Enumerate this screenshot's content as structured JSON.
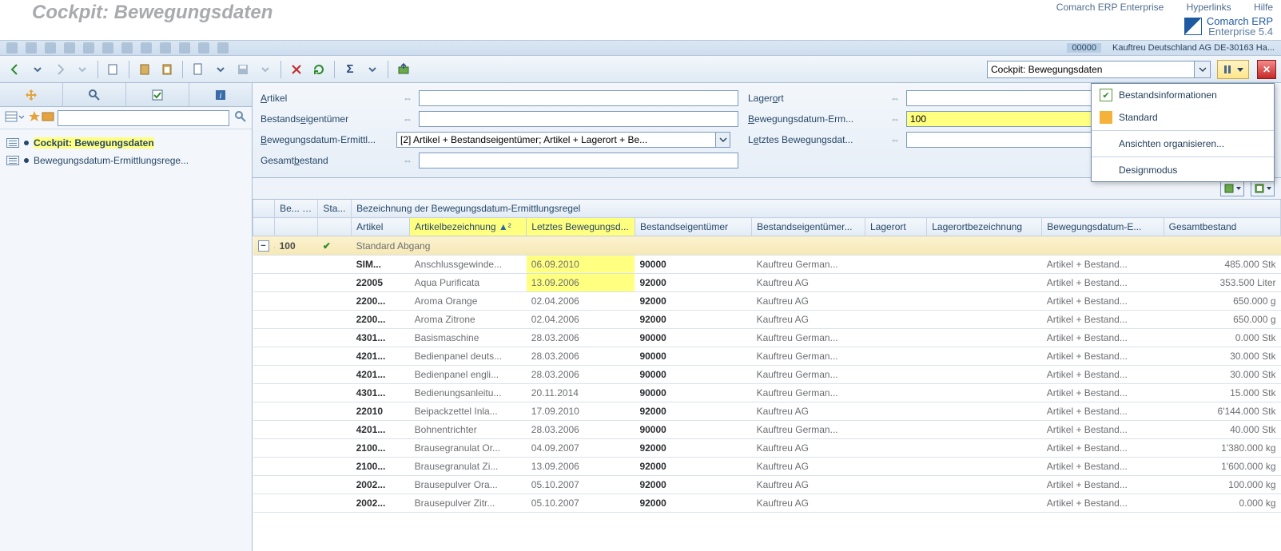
{
  "top": {
    "title": "Cockpit: Bewegungsdaten",
    "links": {
      "erp": "Comarch ERP Enterprise",
      "hyper": "Hyperlinks",
      "help": "Hilfe"
    },
    "brand_l1": "Comarch ERP",
    "brand_l2": "Enterprise 5.4"
  },
  "smallbar": {
    "code": "00000",
    "org": "Kauftreu Deutschland AG  DE-30163 Ha..."
  },
  "toolbar": {
    "combo_value": "Cockpit: Bewegungsdaten"
  },
  "menu": {
    "i1": "Bestandsinformationen",
    "i2": "Standard",
    "i3": "Ansichten organisieren...",
    "i4": "Designmodus"
  },
  "tree": {
    "n1": "Cockpit: Bewegungsdaten",
    "n2": "Bewegungsdatum-Ermittlungsrege..."
  },
  "filter": {
    "artikel": "Artikel",
    "bestandseig": "Bestandseigentümer",
    "bew_regel": "Bewegungsdatum-Ermittl...",
    "bew_regel_under": "B",
    "gesamt": "Gesamtbestand",
    "gesamt_under": "b",
    "lagerort": "Lagerort",
    "lagerort_under": "o",
    "bew_zahl": "Bewegungsdatum-Erm...",
    "bew_zahl_under": "B",
    "bew_zahl_val": "100",
    "letztes": "Letztes Bewegungsdat...",
    "letztes_under": "e",
    "regel_value": "[2] Artikel + Bestandseigentümer; Artikel + Lagerort + Be..."
  },
  "grid": {
    "h1": {
      "be": "Be...",
      "sort": "▲¹",
      "st": "Sta...",
      "rule": "Bezeichnung der Bewegungsdatum-Ermittlungsregel"
    },
    "h2": {
      "art": "Artikel",
      "artb": "Artikelbezeichnung",
      "artb_sort": "▲²",
      "date": "Letztes Bewegungsd...",
      "own": "Bestandseigentümer",
      "ownb": "Bestandseigentümer...",
      "lag": "Lagerort",
      "lagb": "Lagerortbezeichnung",
      "reg": "Bewegungsdatum-E...",
      "tot": "Gesamtbestand"
    },
    "group": {
      "be": "100",
      "rule": "Standard Abgang"
    },
    "rows": [
      {
        "hl": true,
        "art": "SIM...",
        "artb": "Anschlussgewinde...",
        "date": "06.09.2010",
        "own": "90000",
        "ownb": "Kauftreu German...",
        "lag": "",
        "lagb": "",
        "reg": "Artikel + Bestand...",
        "tot": "485.000 Stk"
      },
      {
        "hl": true,
        "art": "22005",
        "artb": "Aqua Purificata",
        "date": "13.09.2006",
        "own": "92000",
        "ownb": "Kauftreu AG",
        "lag": "",
        "lagb": "",
        "reg": "Artikel + Bestand...",
        "tot": "353.500 Liter"
      },
      {
        "hl": false,
        "art": "2200...",
        "artb": "Aroma Orange",
        "date": "02.04.2006",
        "own": "92000",
        "ownb": "Kauftreu AG",
        "lag": "",
        "lagb": "",
        "reg": "Artikel + Bestand...",
        "tot": "650.000 g"
      },
      {
        "hl": false,
        "art": "2200...",
        "artb": "Aroma Zitrone",
        "date": "02.04.2006",
        "own": "92000",
        "ownb": "Kauftreu AG",
        "lag": "",
        "lagb": "",
        "reg": "Artikel + Bestand...",
        "tot": "650.000 g"
      },
      {
        "hl": false,
        "art": "4301...",
        "artb": "Basismaschine",
        "date": "28.03.2006",
        "own": "90000",
        "ownb": "Kauftreu German...",
        "lag": "",
        "lagb": "",
        "reg": "Artikel + Bestand...",
        "tot": "0.000 Stk"
      },
      {
        "hl": false,
        "art": "4201...",
        "artb": "Bedienpanel deuts...",
        "date": "28.03.2006",
        "own": "90000",
        "ownb": "Kauftreu German...",
        "lag": "",
        "lagb": "",
        "reg": "Artikel + Bestand...",
        "tot": "30.000 Stk"
      },
      {
        "hl": false,
        "art": "4201...",
        "artb": "Bedienpanel engli...",
        "date": "28.03.2006",
        "own": "90000",
        "ownb": "Kauftreu German...",
        "lag": "",
        "lagb": "",
        "reg": "Artikel + Bestand...",
        "tot": "30.000 Stk"
      },
      {
        "hl": false,
        "art": "4301...",
        "artb": "Bedienungsanleitu...",
        "date": "20.11.2014",
        "own": "90000",
        "ownb": "Kauftreu German...",
        "lag": "",
        "lagb": "",
        "reg": "Artikel + Bestand...",
        "tot": "15.000 Stk"
      },
      {
        "hl": false,
        "art": "22010",
        "artb": "Beipackzettel Inla...",
        "date": "17.09.2010",
        "own": "92000",
        "ownb": "Kauftreu AG",
        "lag": "",
        "lagb": "",
        "reg": "Artikel + Bestand...",
        "tot": "6'144.000 Stk"
      },
      {
        "hl": false,
        "art": "4201...",
        "artb": "Bohnentrichter",
        "date": "28.03.2006",
        "own": "90000",
        "ownb": "Kauftreu German...",
        "lag": "",
        "lagb": "",
        "reg": "Artikel + Bestand...",
        "tot": "40.000 Stk"
      },
      {
        "hl": false,
        "art": "2100...",
        "artb": "Brausegranulat Or...",
        "date": "04.09.2007",
        "own": "92000",
        "ownb": "Kauftreu AG",
        "lag": "",
        "lagb": "",
        "reg": "Artikel + Bestand...",
        "tot": "1'380.000 kg"
      },
      {
        "hl": false,
        "art": "2100...",
        "artb": "Brausegranulat Zi...",
        "date": "13.09.2006",
        "own": "92000",
        "ownb": "Kauftreu AG",
        "lag": "",
        "lagb": "",
        "reg": "Artikel + Bestand...",
        "tot": "1'600.000 kg"
      },
      {
        "hl": false,
        "art": "2002...",
        "artb": "Brausepulver Ora...",
        "date": "05.10.2007",
        "own": "92000",
        "ownb": "Kauftreu AG",
        "lag": "",
        "lagb": "",
        "reg": "Artikel + Bestand...",
        "tot": "100.000 kg"
      },
      {
        "hl": false,
        "art": "2002...",
        "artb": "Brausepulver Zitr...",
        "date": "05.10.2007",
        "own": "92000",
        "ownb": "Kauftreu AG",
        "lag": "",
        "lagb": "",
        "reg": "Artikel + Bestand...",
        "tot": "0.000 kg"
      }
    ]
  }
}
